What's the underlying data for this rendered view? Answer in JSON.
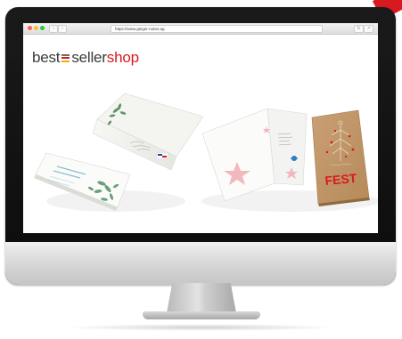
{
  "browser": {
    "url": "https://www.geiger-notes.ag",
    "back_icon": "chevron-left-icon",
    "forward_icon": "chevron-right-icon",
    "refresh_icon": "refresh-icon",
    "share_icon": "share-icon"
  },
  "logo": {
    "part1": "best",
    "part2": "seller",
    "part3": "shop"
  },
  "cards": {
    "festive_card_text": "FEST"
  },
  "colors": {
    "brand_red": "#d71920",
    "brand_grey": "#3a3a3a",
    "kraft": "#c49a6c",
    "star_pink": "#f2b8bd"
  }
}
